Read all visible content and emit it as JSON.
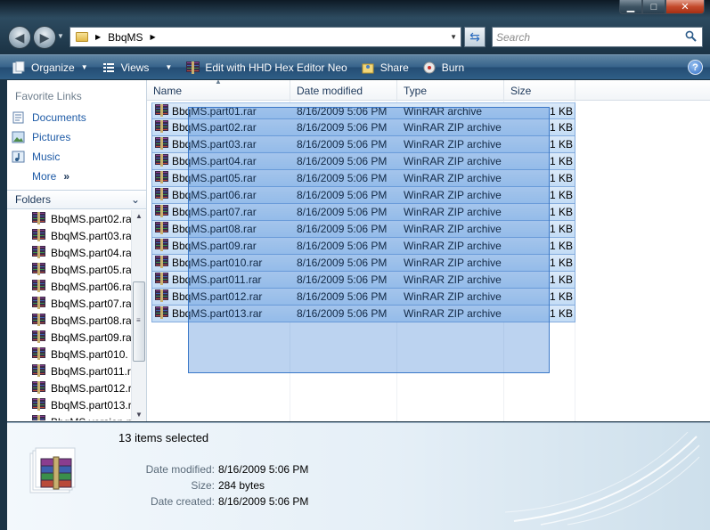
{
  "window": {
    "minimize_icon": "minimize-icon",
    "maximize_icon": "maximize-icon",
    "close_icon": "close-icon"
  },
  "address": {
    "path": "BbqMS"
  },
  "search": {
    "placeholder": "Search"
  },
  "toolbar": {
    "organize": "Organize",
    "views": "Views",
    "hex": "Edit with HHD Hex Editor Neo",
    "share": "Share",
    "burn": "Burn"
  },
  "nav": {
    "favorites_header": "Favorite Links",
    "favorites": [
      "Documents",
      "Pictures",
      "Music",
      "More"
    ],
    "folders_header": "Folders",
    "tree": [
      "BbqMS.part02.ra",
      "BbqMS.part03.ra",
      "BbqMS.part04.ra",
      "BbqMS.part05.ra",
      "BbqMS.part06.ra",
      "BbqMS.part07.ra",
      "BbqMS.part08.ra",
      "BbqMS.part09.ra",
      "BbqMS.part010.",
      "BbqMS.part011.r",
      "BbqMS.part012.r",
      "BbqMS.part013.r",
      "BbqMS.version.n"
    ]
  },
  "columns": [
    "Name",
    "Date modified",
    "Type",
    "Size"
  ],
  "files": [
    {
      "name": "BbqMS.part01.rar",
      "date": "8/16/2009 5:06 PM",
      "type": "WinRAR archive",
      "size": "1 KB"
    },
    {
      "name": "BbqMS.part02.rar",
      "date": "8/16/2009 5:06 PM",
      "type": "WinRAR ZIP archive",
      "size": "1 KB"
    },
    {
      "name": "BbqMS.part03.rar",
      "date": "8/16/2009 5:06 PM",
      "type": "WinRAR ZIP archive",
      "size": "1 KB"
    },
    {
      "name": "BbqMS.part04.rar",
      "date": "8/16/2009 5:06 PM",
      "type": "WinRAR ZIP archive",
      "size": "1 KB"
    },
    {
      "name": "BbqMS.part05.rar",
      "date": "8/16/2009 5:06 PM",
      "type": "WinRAR ZIP archive",
      "size": "1 KB"
    },
    {
      "name": "BbqMS.part06.rar",
      "date": "8/16/2009 5:06 PM",
      "type": "WinRAR ZIP archive",
      "size": "1 KB"
    },
    {
      "name": "BbqMS.part07.rar",
      "date": "8/16/2009 5:06 PM",
      "type": "WinRAR ZIP archive",
      "size": "1 KB"
    },
    {
      "name": "BbqMS.part08.rar",
      "date": "8/16/2009 5:06 PM",
      "type": "WinRAR ZIP archive",
      "size": "1 KB"
    },
    {
      "name": "BbqMS.part09.rar",
      "date": "8/16/2009 5:06 PM",
      "type": "WinRAR ZIP archive",
      "size": "1 KB"
    },
    {
      "name": "BbqMS.part010.rar",
      "date": "8/16/2009 5:06 PM",
      "type": "WinRAR ZIP archive",
      "size": "1 KB"
    },
    {
      "name": "BbqMS.part011.rar",
      "date": "8/16/2009 5:06 PM",
      "type": "WinRAR ZIP archive",
      "size": "1 KB"
    },
    {
      "name": "BbqMS.part012.rar",
      "date": "8/16/2009 5:06 PM",
      "type": "WinRAR ZIP archive",
      "size": "1 KB"
    },
    {
      "name": "BbqMS.part013.rar",
      "date": "8/16/2009 5:06 PM",
      "type": "WinRAR ZIP archive",
      "size": "1 KB"
    }
  ],
  "details": {
    "selected": "13 items selected",
    "date_modified_label": "Date modified:",
    "date_modified": "8/16/2009 5:06 PM",
    "size_label": "Size:",
    "size": "284 bytes",
    "date_created_label": "Date created:",
    "date_created": "8/16/2009 5:06 PM"
  },
  "colors": {
    "selection": "#c3dcf5",
    "selection_border": "#84acdd",
    "toolbar": "#36628a",
    "link": "#1d5aa6"
  }
}
